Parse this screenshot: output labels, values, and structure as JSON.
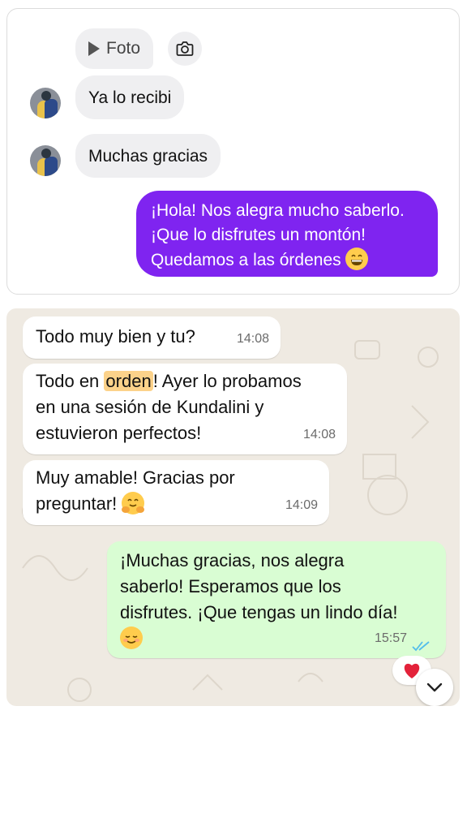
{
  "instagram": {
    "photo_label": "Foto",
    "messages_in": [
      "Ya lo recibi",
      "Muchas gracias"
    ],
    "message_out_lines": [
      "¡Hola! Nos alegra mucho saberlo.",
      "¡Que lo disfrutes un montón!",
      "Quedamos a las órdenes"
    ],
    "colors": {
      "sent_bubble": "#7f24f0",
      "received_bubble": "#efeff1"
    }
  },
  "whatsapp": {
    "messages_in": [
      {
        "lines": [
          "Todo muy bien y tu?"
        ],
        "time": "14:08"
      },
      {
        "lines": [
          "Todo en ",
          "orden",
          "! Ayer lo probamos",
          "en una sesión de Kundalini y",
          "estuvieron perfectos!"
        ],
        "time": "14:08"
      },
      {
        "lines": [
          "Muy amable! Gracias por",
          "preguntar!"
        ],
        "time": "14:09"
      }
    ],
    "message_out": {
      "lines": [
        "¡Muchas gracias, nos alegra",
        "saberlo! Esperamos que los",
        "disfrutes. ¡Que tengas un lindo día!"
      ],
      "time": "15:57",
      "status": "read"
    },
    "reaction_icon": "heart-icon",
    "colors": {
      "sent_bubble": "#d9fdd3",
      "received_bubble": "#ffffff",
      "highlight": "#fcd28a",
      "read_ticks": "#53bdeb"
    }
  }
}
